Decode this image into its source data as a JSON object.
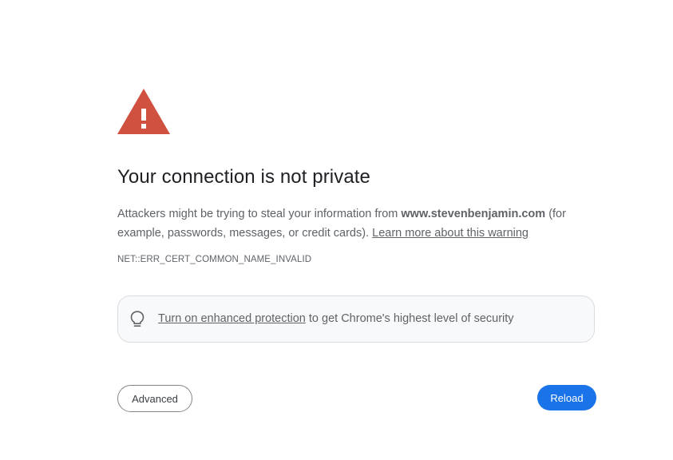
{
  "heading": "Your connection is not private",
  "explanation": {
    "prefix": "Attackers might be trying to steal your information from ",
    "host": "www.stevenbenjamin.com",
    "suffix": " (for example, passwords, messages, or credit cards). ",
    "learn_more_link": "Learn more about this warning"
  },
  "error_code": "NET::ERR_CERT_COMMON_NAME_INVALID",
  "protection": {
    "link": "Turn on enhanced protection",
    "text": " to get Chrome's highest level of security"
  },
  "buttons": {
    "advanced": "Advanced",
    "reload": "Reload"
  },
  "icons": {
    "warning": "warning-triangle-icon",
    "bulb": "lightbulb-icon"
  },
  "colors": {
    "warning_red": "#d0513f",
    "primary_blue": "#1a73e8"
  }
}
